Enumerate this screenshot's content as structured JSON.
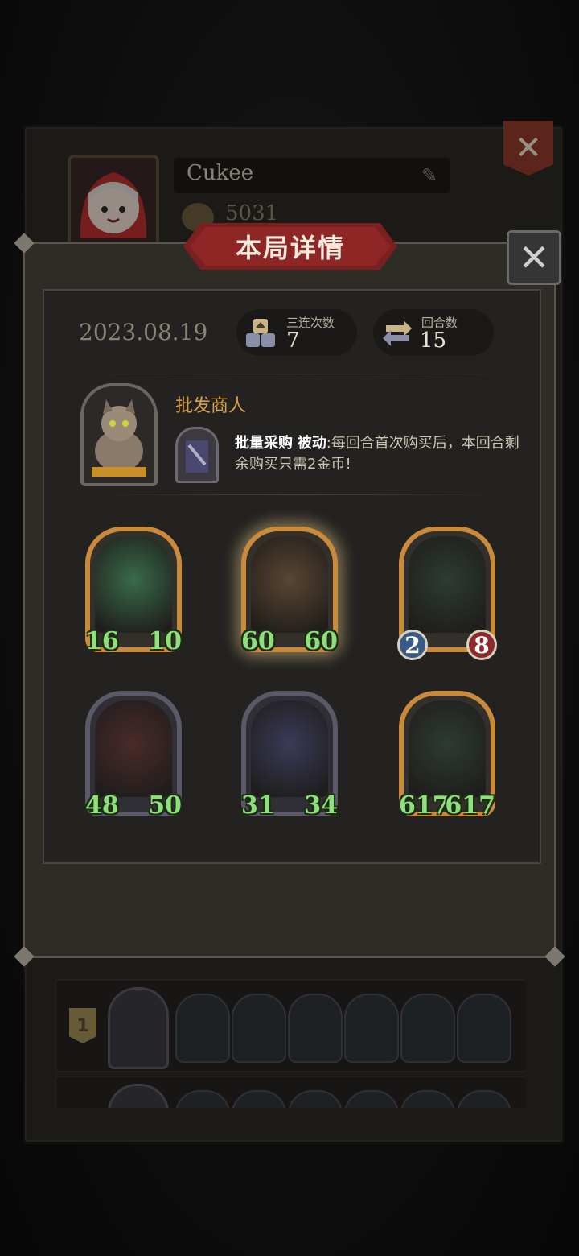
{
  "back": {
    "player_name": "Cukee",
    "gold": "5031",
    "row_rank": "1"
  },
  "modal": {
    "title": "本局详情",
    "date": "2023.08.19",
    "triples_label": "三连次数",
    "triples_value": "7",
    "rounds_label": "回合数",
    "rounds_value": "15"
  },
  "merchant": {
    "name": "批发商人",
    "skill_name": "批量采购",
    "skill_type": "被动",
    "skill_text": ":每回合首次购买后，本回合剩余购买只需2金币!"
  },
  "units": [
    {
      "name": "vine-unit",
      "attack": "16",
      "health": "10",
      "style": "gold",
      "mode": "green",
      "color": "#3a6a4a"
    },
    {
      "name": "treant-unit",
      "attack": "60",
      "health": "60",
      "style": "gold",
      "mode": "green",
      "color": "#5a4632",
      "glow": true
    },
    {
      "name": "flytrap-unit",
      "attack": "2",
      "health": "8",
      "style": "gold",
      "mode": "badge",
      "color": "#2e3a34"
    },
    {
      "name": "tomato-unit",
      "attack": "48",
      "health": "50",
      "style": "purple",
      "mode": "green",
      "color": "#4a2a2a"
    },
    {
      "name": "elf-unit",
      "attack": "31",
      "health": "34",
      "style": "purple",
      "mode": "green",
      "color": "#3a3a58"
    },
    {
      "name": "flytrap-golden-unit",
      "attack": "617",
      "health": "617",
      "style": "gold",
      "mode": "green",
      "color": "#2e3a34"
    }
  ]
}
